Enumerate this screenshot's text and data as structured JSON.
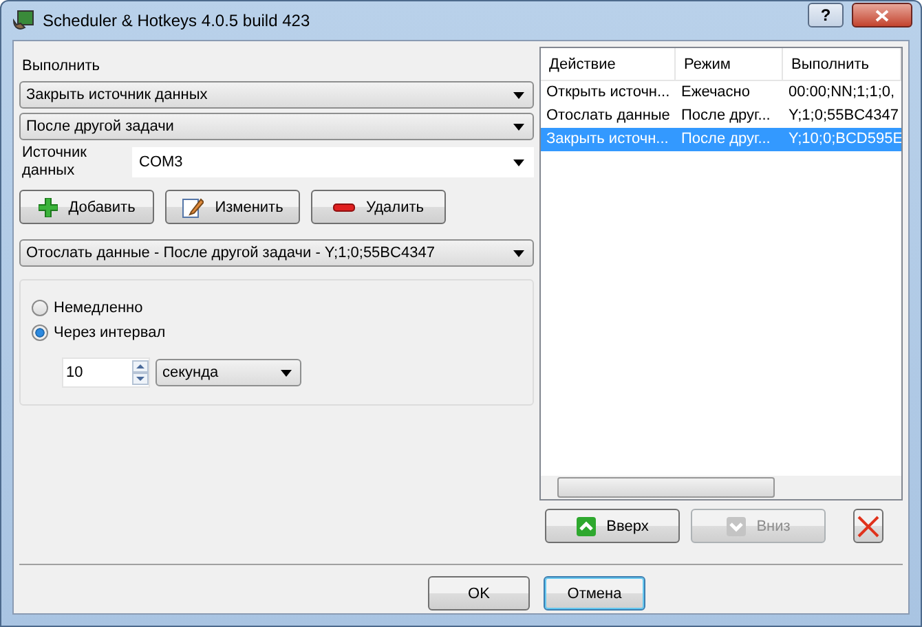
{
  "window": {
    "title": "Scheduler & Hotkeys 4.0.5 build 423",
    "help": "?"
  },
  "execute_label": "Выполнить",
  "action_select": {
    "value": "Закрыть источник данных"
  },
  "mode_select": {
    "value": "После другой задачи"
  },
  "source": {
    "label": "Источник данных",
    "value": "COM3"
  },
  "task_buttons": [
    {
      "kind": "add",
      "label": "Добавить"
    },
    {
      "kind": "edit",
      "label": "Изменить"
    },
    {
      "kind": "remove",
      "label": "Удалить"
    }
  ],
  "task_select": {
    "value": "Отослать данные - После другой задачи - Y;1;0;55BC4347"
  },
  "timing": [
    {
      "label": "Немедленно",
      "selected": false
    },
    {
      "label": "Через интервал",
      "selected": true
    }
  ],
  "interval": {
    "value": "10",
    "unit": "секунда"
  },
  "table": {
    "columns": [
      "Действие",
      "Режим",
      "Выполнить"
    ],
    "rows": [
      {
        "cells": [
          "Открыть источн...",
          "Ежечасно",
          "00:00;NN;1;1;0,"
        ],
        "selected": false
      },
      {
        "cells": [
          "Отослать данные",
          "После друг...",
          "Y;1;0;55BC4347"
        ],
        "selected": false
      },
      {
        "cells": [
          "Закрыть источн...",
          "После друг...",
          "Y;10;0;BCD595E"
        ],
        "selected": true
      }
    ]
  },
  "move_buttons": [
    {
      "kind": "up",
      "label": "Вверх",
      "disabled": false
    },
    {
      "kind": "down",
      "label": "Вниз",
      "disabled": true
    }
  ],
  "dialog_buttons": [
    {
      "label": "OK",
      "default": false
    },
    {
      "label": "Отмена",
      "default": true
    }
  ]
}
